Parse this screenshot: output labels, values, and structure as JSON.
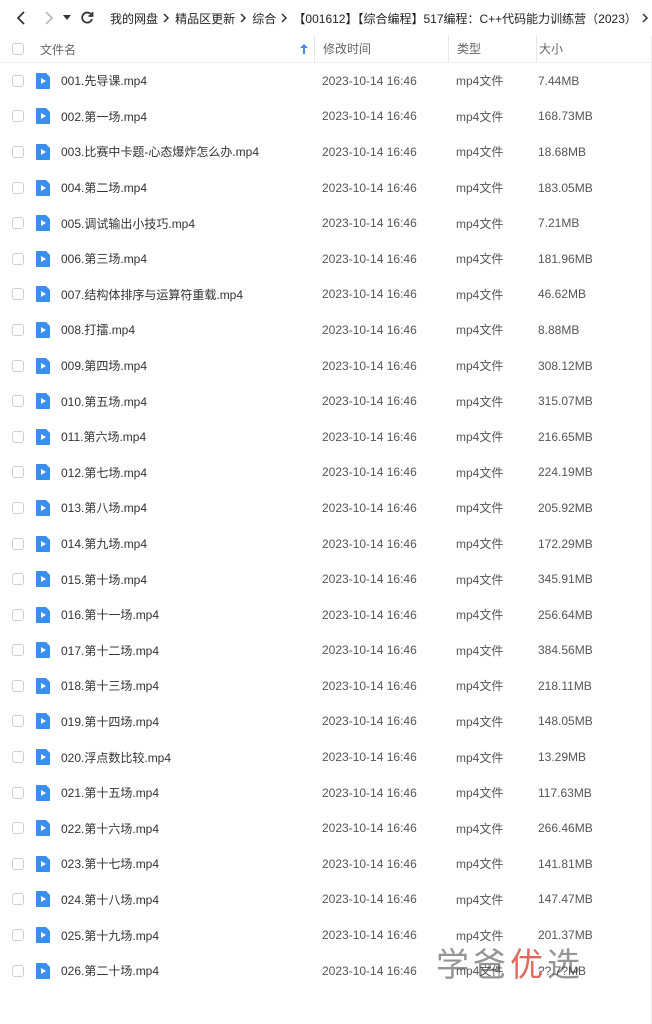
{
  "breadcrumb": [
    "我的网盘",
    "精品区更新",
    "综合",
    "【001612】【综合编程】517编程：C++代码能力训练营（2023）"
  ],
  "columns": {
    "name": "文件名",
    "time": "修改时间",
    "type": "类型",
    "size": "大小"
  },
  "files": [
    {
      "name": "001.先导课.mp4",
      "time": "2023-10-14 16:46",
      "type": "mp4文件",
      "size": "7.44MB"
    },
    {
      "name": "002.第一场.mp4",
      "time": "2023-10-14 16:46",
      "type": "mp4文件",
      "size": "168.73MB"
    },
    {
      "name": "003.比赛中卡题-心态爆炸怎么办.mp4",
      "time": "2023-10-14 16:46",
      "type": "mp4文件",
      "size": "18.68MB"
    },
    {
      "name": "004.第二场.mp4",
      "time": "2023-10-14 16:46",
      "type": "mp4文件",
      "size": "183.05MB"
    },
    {
      "name": "005.调试输出小技巧.mp4",
      "time": "2023-10-14 16:46",
      "type": "mp4文件",
      "size": "7.21MB"
    },
    {
      "name": "006.第三场.mp4",
      "time": "2023-10-14 16:46",
      "type": "mp4文件",
      "size": "181.96MB"
    },
    {
      "name": "007.结构体排序与运算符重载.mp4",
      "time": "2023-10-14 16:46",
      "type": "mp4文件",
      "size": "46.62MB"
    },
    {
      "name": "008.打擂.mp4",
      "time": "2023-10-14 16:46",
      "type": "mp4文件",
      "size": "8.88MB"
    },
    {
      "name": "009.第四场.mp4",
      "time": "2023-10-14 16:46",
      "type": "mp4文件",
      "size": "308.12MB"
    },
    {
      "name": "010.第五场.mp4",
      "time": "2023-10-14 16:46",
      "type": "mp4文件",
      "size": "315.07MB"
    },
    {
      "name": "011.第六场.mp4",
      "time": "2023-10-14 16:46",
      "type": "mp4文件",
      "size": "216.65MB"
    },
    {
      "name": "012.第七场.mp4",
      "time": "2023-10-14 16:46",
      "type": "mp4文件",
      "size": "224.19MB"
    },
    {
      "name": "013.第八场.mp4",
      "time": "2023-10-14 16:46",
      "type": "mp4文件",
      "size": "205.92MB"
    },
    {
      "name": "014.第九场.mp4",
      "time": "2023-10-14 16:46",
      "type": "mp4文件",
      "size": "172.29MB"
    },
    {
      "name": "015.第十场.mp4",
      "time": "2023-10-14 16:46",
      "type": "mp4文件",
      "size": "345.91MB"
    },
    {
      "name": "016.第十一场.mp4",
      "time": "2023-10-14 16:46",
      "type": "mp4文件",
      "size": "256.64MB"
    },
    {
      "name": "017.第十二场.mp4",
      "time": "2023-10-14 16:46",
      "type": "mp4文件",
      "size": "384.56MB"
    },
    {
      "name": "018.第十三场.mp4",
      "time": "2023-10-14 16:46",
      "type": "mp4文件",
      "size": "218.11MB"
    },
    {
      "name": "019.第十四场.mp4",
      "time": "2023-10-14 16:46",
      "type": "mp4文件",
      "size": "148.05MB"
    },
    {
      "name": "020.浮点数比较.mp4",
      "time": "2023-10-14 16:46",
      "type": "mp4文件",
      "size": "13.29MB"
    },
    {
      "name": "021.第十五场.mp4",
      "time": "2023-10-14 16:46",
      "type": "mp4文件",
      "size": "117.63MB"
    },
    {
      "name": "022.第十六场.mp4",
      "time": "2023-10-14 16:46",
      "type": "mp4文件",
      "size": "266.46MB"
    },
    {
      "name": "023.第十七场.mp4",
      "time": "2023-10-14 16:46",
      "type": "mp4文件",
      "size": "141.81MB"
    },
    {
      "name": "024.第十八场.mp4",
      "time": "2023-10-14 16:46",
      "type": "mp4文件",
      "size": "147.47MB"
    },
    {
      "name": "025.第十九场.mp4",
      "time": "2023-10-14 16:46",
      "type": "mp4文件",
      "size": "201.37MB"
    },
    {
      "name": "026.第二十场.mp4",
      "time": "2023-10-14 16:46",
      "type": "mp4文件",
      "size": "??.7?MB"
    }
  ],
  "watermark": {
    "part1": "学爸",
    "part2": "优",
    "part3": "选"
  },
  "colors": {
    "accent": "#3a8ef0",
    "text": "#333333",
    "muted": "#666666"
  }
}
